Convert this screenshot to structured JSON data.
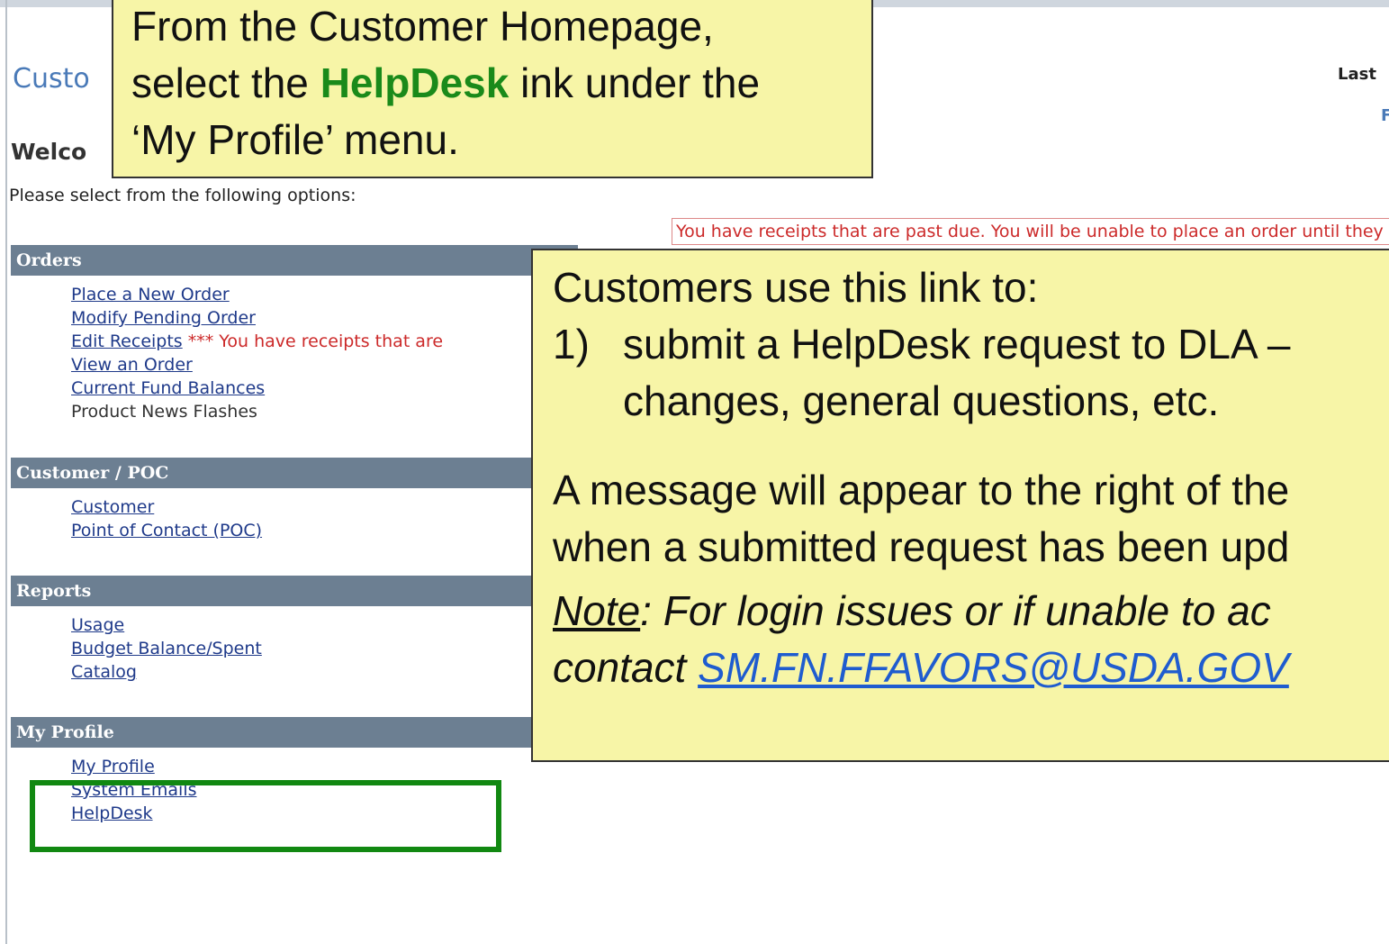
{
  "page": {
    "heading": "Custo",
    "welcome": "Welco",
    "instructions": "Please select from the following options:",
    "last_label": "Last",
    "right_fragment": "F",
    "alert": "You have receipts that are past due. You will be unable to place an order until they are edited."
  },
  "menu": {
    "orders": {
      "header": "Orders",
      "items": [
        "Place a New Order",
        "Modify Pending Order",
        "Edit Receipts",
        "View an Order",
        "Current Fund Balances",
        "Product News Flashes"
      ],
      "receipt_note": "*** You have receipts that are"
    },
    "customer_poc": {
      "header": "Customer / POC",
      "items": [
        "Customer",
        "Point of Contact (POC)"
      ]
    },
    "reports": {
      "header": "Reports",
      "items": [
        "Usage",
        "Budget Balance/Spent",
        "Catalog"
      ]
    },
    "my_profile": {
      "header": "My Profile",
      "items": [
        "My Profile",
        "System Emails",
        "HelpDesk"
      ]
    }
  },
  "callout1": {
    "line1": "From the Customer Homepage,",
    "pre": "select the ",
    "highlight": "HelpDesk",
    "post": " ink under the",
    "line3": "‘My Profile’ menu."
  },
  "callout2": {
    "intro": "Customers use this link to:",
    "item_num": "1)",
    "item_line1": "submit a HelpDesk request to DLA –",
    "item_line2": "changes, general questions, etc.",
    "msg_line1": "A message will appear to the right of the",
    "msg_line2": "when a submitted request has been upd",
    "note_label": "Note",
    "note_rest": ":  For login issues or if unable to ac",
    "contact_label": "contact ",
    "email": "SM.FN.FFAVORS@USDA.GOV"
  },
  "colors": {
    "callout_bg": "#f7f5a7",
    "section_header": "#6c7f92",
    "link": "#1f3a8a",
    "alert": "#cc2a2a",
    "highlight_border": "#118811",
    "helpdesk_highlight": "#1a8a1a"
  }
}
